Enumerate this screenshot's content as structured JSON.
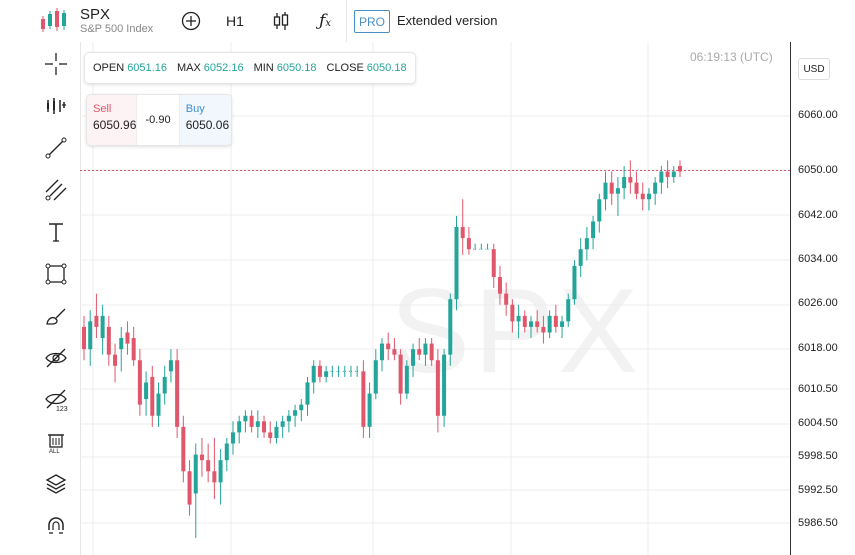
{
  "header": {
    "symbol": "SPX",
    "symbol_sub": "S&P 500 Index",
    "timeframe": "H1",
    "pro_label": "PRO",
    "extended_label": "Extended version",
    "add_icon": "plus-circle-icon",
    "candles_icon": "candles-icon",
    "indicator_icon": "function-icon"
  },
  "ohlc": {
    "open_label": "OPEN",
    "open_value": "6051.16",
    "max_label": "MAX",
    "max_value": "6052.16",
    "min_label": "MIN",
    "min_value": "6050.18",
    "close_label": "CLOSE",
    "close_value": "6050.18"
  },
  "trade": {
    "sell_label": "Sell",
    "sell_value": "6050.96",
    "diff": "-0.90",
    "buy_label": "Buy",
    "buy_value": "6050.06"
  },
  "clock": "06:19:13 (UTC)",
  "watermark": "SPX",
  "axis": {
    "currency": "USD",
    "ticks": [
      "6060.00",
      "6050.00",
      "6042.00",
      "6034.00",
      "6026.00",
      "6018.00",
      "6010.50",
      "6004.50",
      "5998.50",
      "5992.50",
      "5986.50"
    ]
  },
  "tools": [
    "crosshair-icon",
    "bars-icon",
    "trend-line-icon",
    "fib-icon",
    "text-icon",
    "rectangle-icon",
    "brush-icon",
    "hide-drawings-icon",
    "hide-indicators-icon",
    "delete-all-icon",
    "magnet-icon"
  ],
  "colors": {
    "up": "#23a59a",
    "down": "#e0566a",
    "price_line": "#e0566a"
  },
  "chart_data": {
    "type": "candlestick",
    "ylim": [
      5984,
      6066
    ],
    "current_price": 6050.18,
    "candles": [
      [
        6022,
        6024,
        6016,
        6018
      ],
      [
        6018,
        6025,
        6015,
        6023
      ],
      [
        6024,
        6028,
        6020,
        6022
      ],
      [
        6020,
        6026,
        6017,
        6024
      ],
      [
        6022,
        6024,
        6015,
        6017
      ],
      [
        6017,
        6019,
        6012,
        6015
      ],
      [
        6018,
        6022,
        6014,
        6020
      ],
      [
        6021,
        6023,
        6017,
        6019
      ],
      [
        6020,
        6022,
        6015,
        6016
      ],
      [
        6016,
        6018,
        6006,
        6008
      ],
      [
        6009,
        6014,
        6006,
        6012
      ],
      [
        6013,
        6015,
        6004,
        6006
      ],
      [
        6006,
        6012,
        6004,
        6010
      ],
      [
        6010,
        6015,
        6008,
        6013
      ],
      [
        6014,
        6018,
        6012,
        6016
      ],
      [
        6016,
        6018,
        6002,
        6004
      ],
      [
        6004,
        6006,
        5994,
        5996
      ],
      [
        5996,
        5998,
        5988,
        5990
      ],
      [
        5992,
        6001,
        5984,
        5999
      ],
      [
        5999,
        6002,
        5995,
        5998
      ],
      [
        5998,
        6001,
        5994,
        5996
      ],
      [
        5996,
        6002,
        5991,
        5994
      ],
      [
        5994,
        6000,
        5990,
        5998
      ],
      [
        5998,
        6002,
        5996,
        6001
      ],
      [
        6001,
        6005,
        5999,
        6003
      ],
      [
        6003,
        6006,
        6001,
        6005
      ],
      [
        6005,
        6007,
        6003,
        6006
      ],
      [
        6006,
        6007,
        6003,
        6004
      ],
      [
        6004,
        6007,
        6002,
        6005
      ],
      [
        6005,
        6006,
        6002,
        6003
      ],
      [
        6003,
        6005,
        6001,
        6002
      ],
      [
        6002,
        6005,
        6001,
        6004
      ],
      [
        6004,
        6006,
        6002,
        6005
      ],
      [
        6005,
        6007,
        6003,
        6006
      ],
      [
        6006,
        6008,
        6004,
        6007
      ],
      [
        6007,
        6009,
        6005,
        6008
      ],
      [
        6008,
        6013,
        6006,
        6012
      ],
      [
        6012,
        6016,
        6010,
        6015
      ],
      [
        6015,
        6016,
        6012,
        6013
      ],
      [
        6013,
        6015,
        6012,
        6014
      ],
      [
        6014,
        6015,
        6013,
        6014
      ],
      [
        6014,
        6015,
        6013,
        6014
      ],
      [
        6014,
        6015,
        6013,
        6014
      ],
      [
        6014,
        6015,
        6013,
        6014
      ],
      [
        6014,
        6015,
        6013,
        6014
      ],
      [
        6014,
        6016,
        6002,
        6004
      ],
      [
        6004,
        6012,
        6002,
        6010
      ],
      [
        6010,
        6018,
        6009,
        6016
      ],
      [
        6016,
        6020,
        6014,
        6019
      ],
      [
        6019,
        6021,
        6016,
        6018
      ],
      [
        6018,
        6020,
        6016,
        6017
      ],
      [
        6017,
        6018,
        6008,
        6010
      ],
      [
        6010,
        6016,
        6009,
        6015
      ],
      [
        6015,
        6019,
        6013,
        6018
      ],
      [
        6018,
        6020,
        6016,
        6017
      ],
      [
        6017,
        6020,
        6015,
        6019
      ],
      [
        6019,
        6020,
        6015,
        6016
      ],
      [
        6016,
        6018,
        6003,
        6006
      ],
      [
        6006,
        6018,
        6004,
        6017
      ],
      [
        6017,
        6028,
        6015,
        6027
      ],
      [
        6027,
        6042,
        6025,
        6040
      ],
      [
        6040,
        6045,
        6035,
        6038
      ],
      [
        6038,
        6040,
        6035,
        6036
      ],
      [
        6036,
        6037,
        6036,
        6036
      ],
      [
        6036,
        6037,
        6036,
        6036
      ],
      [
        6036,
        6037,
        6036,
        6036
      ],
      [
        6036,
        6037,
        6029,
        6031
      ],
      [
        6031,
        6033,
        6026,
        6028
      ],
      [
        6028,
        6030,
        6024,
        6026
      ],
      [
        6026,
        6027,
        6021,
        6023
      ],
      [
        6023,
        6026,
        6020,
        6024
      ],
      [
        6024,
        6025,
        6021,
        6022
      ],
      [
        6022,
        6024,
        6020,
        6023
      ],
      [
        6023,
        6025,
        6021,
        6022
      ],
      [
        6022,
        6024,
        6019,
        6021
      ],
      [
        6021,
        6025,
        6020,
        6024
      ],
      [
        6024,
        6026,
        6021,
        6022
      ],
      [
        6022,
        6024,
        6020,
        6023
      ],
      [
        6023,
        6028,
        6022,
        6027
      ],
      [
        6027,
        6034,
        6026,
        6033
      ],
      [
        6033,
        6038,
        6031,
        6036
      ],
      [
        6036,
        6040,
        6034,
        6038
      ],
      [
        6038,
        6042,
        6036,
        6041
      ],
      [
        6041,
        6046,
        6039,
        6045
      ],
      [
        6045,
        6050,
        6043,
        6048
      ],
      [
        6048,
        6050,
        6044,
        6046
      ],
      [
        6046,
        6049,
        6042,
        6047
      ],
      [
        6047,
        6051,
        6045,
        6049
      ],
      [
        6049,
        6052,
        6046,
        6048
      ],
      [
        6048,
        6050,
        6045,
        6046
      ],
      [
        6046,
        6048,
        6043,
        6045
      ],
      [
        6045,
        6047,
        6043,
        6046
      ],
      [
        6046,
        6049,
        6044,
        6048
      ],
      [
        6048,
        6051,
        6046,
        6050
      ],
      [
        6050,
        6052,
        6047,
        6049
      ],
      [
        6049,
        6051,
        6048,
        6050
      ],
      [
        6051,
        6052,
        6049,
        6050
      ]
    ]
  }
}
